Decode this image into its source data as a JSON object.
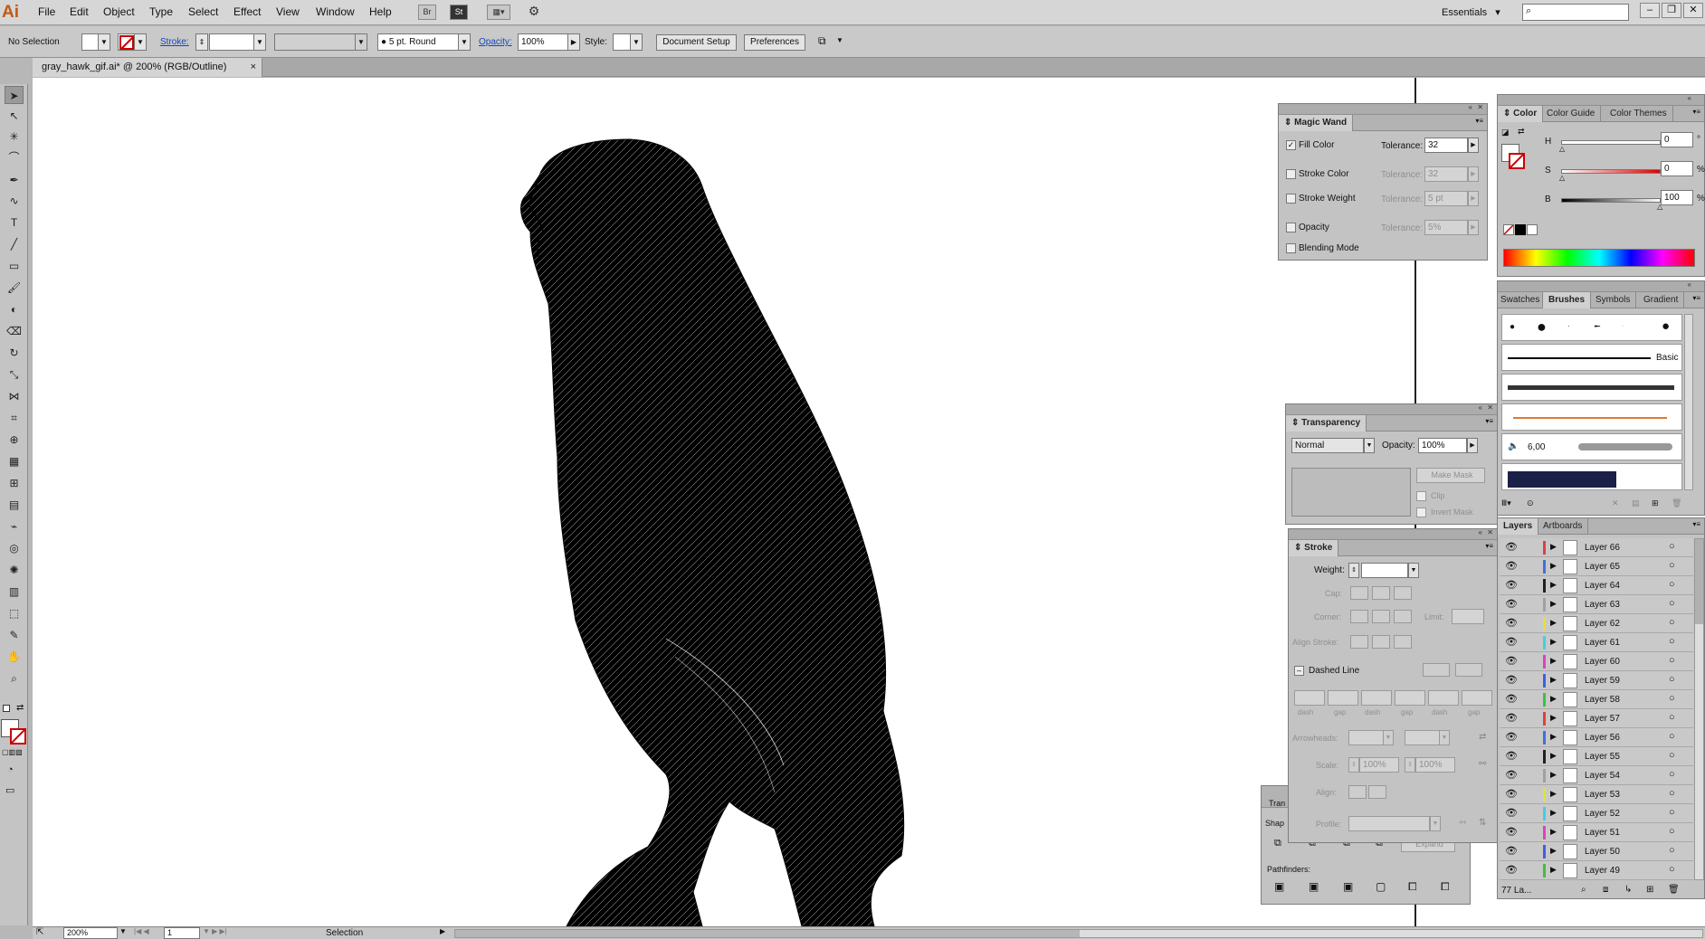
{
  "menubar": {
    "logo": "Ai",
    "items": [
      "File",
      "Edit",
      "Object",
      "Type",
      "Select",
      "Effect",
      "View",
      "Window",
      "Help"
    ],
    "icon_br": "Br",
    "icon_st": "St",
    "workspace": "Essentials",
    "workspace_arrow": "▾",
    "win_min": "–",
    "win_max": "❐",
    "win_close": "✕"
  },
  "controlbar": {
    "selection": "No Selection",
    "stroke_label": "Stroke:",
    "brush": "5 pt. Round",
    "opacity_label": "Opacity:",
    "opacity_value": "100%",
    "style_label": "Style:",
    "document_setup": "Document Setup",
    "preferences": "Preferences"
  },
  "document": {
    "tab_title": "gray_hawk_gif.ai* @ 200% (RGB/Outline)",
    "tab_close": "×"
  },
  "statusbar": {
    "zoom": "200%",
    "page": "1",
    "tool": "Selection"
  },
  "magic_wand": {
    "title": "Magic Wand",
    "tolerance_label": "Tolerance:",
    "fill_color": "Fill Color",
    "fill_tolerance": "32",
    "stroke_color": "Stroke Color",
    "stroke_tolerance": "32",
    "stroke_weight": "Stroke Weight",
    "weight_tolerance": "5 pt",
    "opacity": "Opacity",
    "opacity_tolerance": "5%",
    "blending_mode": "Blending Mode"
  },
  "transparency": {
    "title": "Transparency",
    "mode": "Normal",
    "opacity_label": "Opacity:",
    "opacity_value": "100%",
    "make_mask": "Make Mask",
    "clip": "Clip",
    "invert_mask": "Invert Mask"
  },
  "stroke_panel": {
    "title": "Stroke",
    "weight_label": "Weight:",
    "cap_label": "Cap:",
    "corner_label": "Corner:",
    "limit_label": "Limit:",
    "align_label": "Align Stroke:",
    "dashed_line": "Dashed Line",
    "dash_labels": [
      "dash",
      "gap",
      "dash",
      "gap",
      "dash",
      "gap"
    ],
    "arrowheads_label": "Arrowheads:",
    "scale_label": "Scale:",
    "scale_start": "100%",
    "scale_end": "100%",
    "align2_label": "Align:",
    "profile_label": "Profile:"
  },
  "pathfinder": {
    "title_partial": "Tran",
    "shape_partial": "Shap",
    "expand": "Expand",
    "pathfinders_label": "Pathfinders:"
  },
  "color_panel": {
    "tabs": [
      "Color",
      "Color Guide",
      "Color Themes"
    ],
    "h_label": "H",
    "h_value": "0",
    "h_unit": "°",
    "s_label": "S",
    "s_value": "0",
    "s_unit": "%",
    "b_label": "B",
    "b_value": "100",
    "b_unit": "%"
  },
  "brushes_panel": {
    "tabs": [
      "Swatches",
      "Brushes",
      "Symbols",
      "Gradient"
    ],
    "basic_label": "Basic",
    "brush_size": "6,00"
  },
  "layers_panel": {
    "tabs": [
      "Layers",
      "Artboards"
    ],
    "footer_count": "77 La...",
    "layers": [
      {
        "name": "Layer 66",
        "color": "#e04040"
      },
      {
        "name": "Layer 65",
        "color": "#4070e0"
      },
      {
        "name": "Layer 64",
        "color": "#202020"
      },
      {
        "name": "Layer 63",
        "color": "#a0a0a0"
      },
      {
        "name": "Layer 62",
        "color": "#e0e040"
      },
      {
        "name": "Layer 61",
        "color": "#40d0e0"
      },
      {
        "name": "Layer 60",
        "color": "#e040c0"
      },
      {
        "name": "Layer 59",
        "color": "#4060e0"
      },
      {
        "name": "Layer 58",
        "color": "#40c040"
      },
      {
        "name": "Layer 57",
        "color": "#e04040"
      },
      {
        "name": "Layer 56",
        "color": "#4070e0"
      },
      {
        "name": "Layer 55",
        "color": "#202020"
      },
      {
        "name": "Layer 54",
        "color": "#a0a0a0"
      },
      {
        "name": "Layer 53",
        "color": "#e0e040"
      },
      {
        "name": "Layer 52",
        "color": "#40d0e0"
      },
      {
        "name": "Layer 51",
        "color": "#e040c0"
      },
      {
        "name": "Layer 50",
        "color": "#4060e0"
      },
      {
        "name": "Layer 49",
        "color": "#40c040"
      }
    ]
  }
}
